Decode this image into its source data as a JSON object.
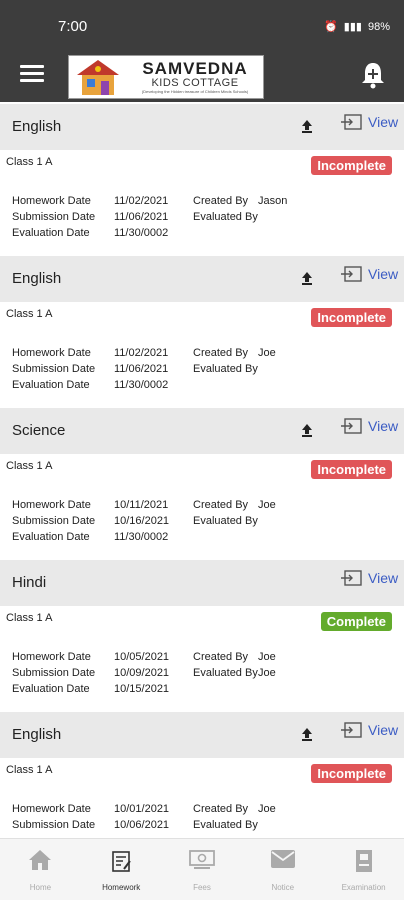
{
  "status_bar": {
    "time": "7:00",
    "battery": "98%"
  },
  "app": {
    "logo_title": "SAMVEDNA",
    "logo_subtitle": "KIDS COTTAGE",
    "logo_tagline": "(Developing the Hidden treasure of Children Minds Schools)"
  },
  "labels": {
    "homework_date": "Homework Date",
    "submission_date": "Submission Date",
    "evaluation_date": "Evaluation Date",
    "created_by": "Created By",
    "evaluated_by": "Evaluated By",
    "view": "View"
  },
  "homework": [
    {
      "subject": "English",
      "class": "Class 1 A",
      "status": "Incomplete",
      "homework_date": "11/02/2021",
      "submission_date": "11/06/2021",
      "evaluation_date": "11/30/0002",
      "created_by": "Jason",
      "evaluated_by": "",
      "has_upload": true
    },
    {
      "subject": "English",
      "class": "Class 1 A",
      "status": "Incomplete",
      "homework_date": "11/02/2021",
      "submission_date": "11/06/2021",
      "evaluation_date": "11/30/0002",
      "created_by": "Joe",
      "evaluated_by": "",
      "has_upload": true
    },
    {
      "subject": "Science",
      "class": "Class 1 A",
      "status": "Incomplete",
      "homework_date": "10/11/2021",
      "submission_date": "10/16/2021",
      "evaluation_date": "11/30/0002",
      "created_by": "Joe",
      "evaluated_by": "",
      "has_upload": true
    },
    {
      "subject": "Hindi",
      "class": "Class 1 A",
      "status": "Complete",
      "homework_date": "10/05/2021",
      "submission_date": "10/09/2021",
      "evaluation_date": "10/15/2021",
      "created_by": "Joe",
      "evaluated_by": "Joe",
      "has_upload": false
    },
    {
      "subject": "English",
      "class": "Class 1 A",
      "status": "Incomplete",
      "homework_date": "10/01/2021",
      "submission_date": "10/06/2021",
      "evaluation_date": "",
      "created_by": "Joe",
      "evaluated_by": "",
      "has_upload": true
    }
  ],
  "bottom_nav": [
    {
      "label": "Home",
      "icon": "home-icon",
      "active": false
    },
    {
      "label": "Homework",
      "icon": "homework-icon",
      "active": true
    },
    {
      "label": "Fees",
      "icon": "fees-icon",
      "active": false
    },
    {
      "label": "Notice",
      "icon": "notice-icon",
      "active": false
    },
    {
      "label": "Examination",
      "icon": "examination-icon",
      "active": false
    }
  ],
  "colors": {
    "app_bar": "#3d3d3d",
    "incomplete": "#e05558",
    "complete": "#63ab2c",
    "link": "#3b5cc4"
  }
}
